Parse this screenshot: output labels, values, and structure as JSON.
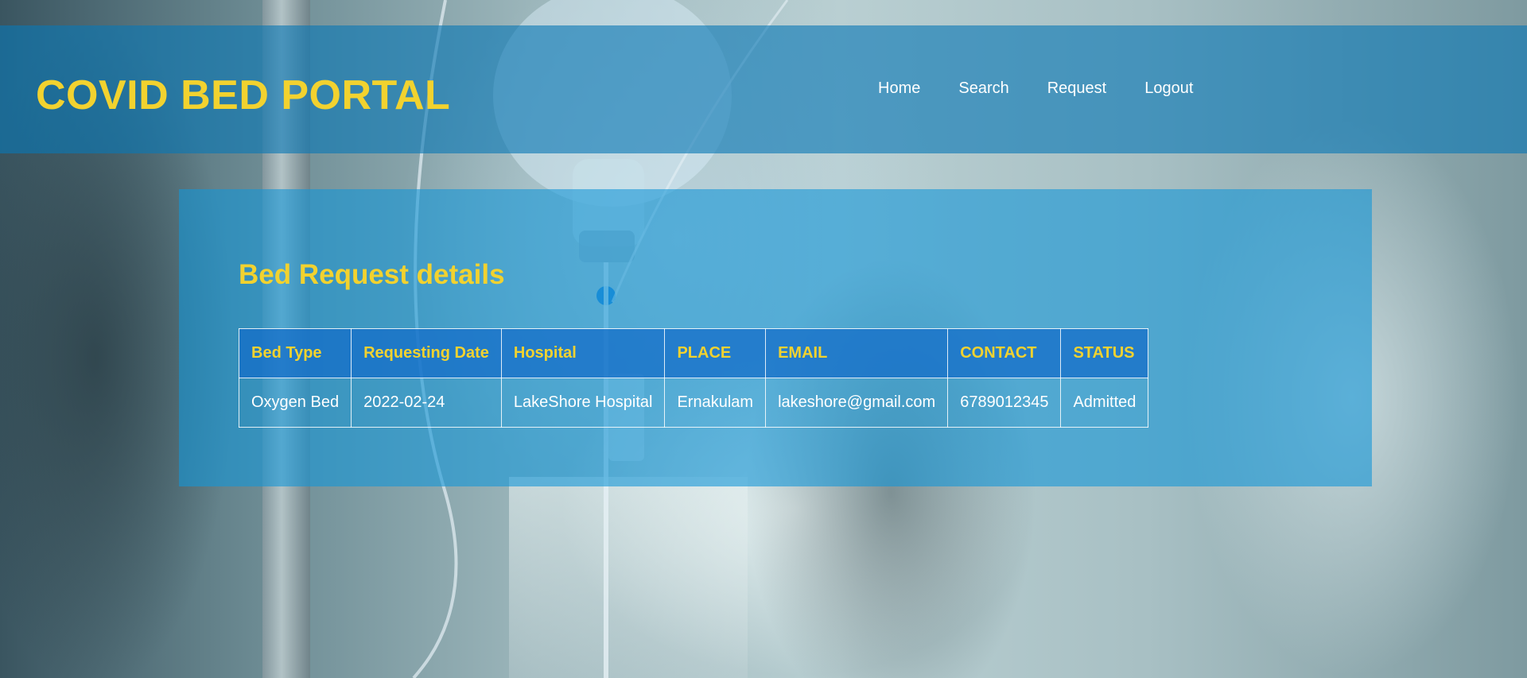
{
  "app": {
    "brand": "COVID BED PORTAL"
  },
  "nav": {
    "items": [
      {
        "label": "Home"
      },
      {
        "label": "Search"
      },
      {
        "label": "Request"
      },
      {
        "label": "Logout"
      }
    ]
  },
  "main": {
    "title": "Bed Request details",
    "table": {
      "headers": [
        "Bed Type",
        "Requesting Date",
        "Hospital",
        "PLACE",
        "EMAIL",
        "CONTACT",
        "STATUS"
      ],
      "rows": [
        {
          "bed_type": "Oxygen Bed",
          "requesting_date": "2022-02-24",
          "hospital": "LakeShore Hospital",
          "place": "Ernakulam",
          "email": "lakeshore@gmail.com",
          "contact": "6789012345",
          "status": "Admitted"
        }
      ]
    }
  },
  "colors": {
    "accent": "#f2d22f",
    "header_bg": "#0a78b4",
    "panel_bg": "#1496d7"
  }
}
